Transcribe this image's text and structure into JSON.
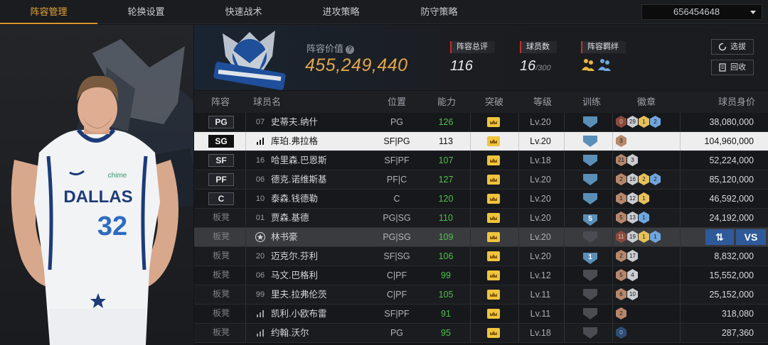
{
  "nav": {
    "tabs": [
      "阵容管理",
      "轮换设置",
      "快速战术",
      "进攻策略",
      "防守策略"
    ],
    "active_index": 0,
    "account_id": "656454648"
  },
  "team": {
    "value_label": "阵容价值",
    "value": "455,249,440",
    "stats": [
      {
        "label": "阵容总评",
        "value": "116"
      },
      {
        "label": "球员数",
        "value": "16",
        "suffix": "/300"
      },
      {
        "label": "阵容羁绊",
        "value": ""
      }
    ],
    "buttons": {
      "pick": "选拔",
      "recycle": "回收"
    }
  },
  "table": {
    "headers": [
      "阵容",
      "球员名",
      "位置",
      "能力",
      "突破",
      "等级",
      "训练",
      "徽章",
      "球员身价"
    ],
    "rows": [
      {
        "slot": "PG",
        "starter": true,
        "num": "07",
        "name": "史蒂夫.纳什",
        "pos": "PG",
        "ability": "126",
        "level": "Lv.20",
        "train": "crown",
        "badges": [
          [
            "red",
            "0"
          ],
          [
            "silver",
            "29"
          ],
          [
            "gold",
            "1"
          ],
          [
            "blue",
            "2"
          ]
        ],
        "value": "38,080,000"
      },
      {
        "slot": "SG",
        "starter": true,
        "num": "bars",
        "name": "库珀.弗拉格",
        "pos": "SF|PG",
        "ability": "113",
        "level": "Lv.20",
        "train": "crown",
        "badges": [
          [
            "bronze",
            "3"
          ]
        ],
        "value": "104,960,000",
        "selected": true
      },
      {
        "slot": "SF",
        "starter": true,
        "num": "16",
        "name": "哈里森.巴恩斯",
        "pos": "SF|PF",
        "ability": "107",
        "level": "Lv.18",
        "train": "crown",
        "badges": [
          [
            "bronze",
            "21"
          ],
          [
            "silver",
            "3"
          ]
        ],
        "value": "52,224,000"
      },
      {
        "slot": "PF",
        "starter": true,
        "num": "06",
        "name": "德克.诺维斯基",
        "pos": "PF|C",
        "ability": "127",
        "level": "Lv.20",
        "train": "crown",
        "badges": [
          [
            "bronze",
            "2"
          ],
          [
            "silver",
            "16"
          ],
          [
            "gold",
            "2"
          ],
          [
            "blue",
            "2"
          ]
        ],
        "value": "85,120,000"
      },
      {
        "slot": "C",
        "starter": true,
        "num": "10",
        "name": "泰森.钱德勒",
        "pos": "C",
        "ability": "120",
        "level": "Lv.20",
        "train": "crown",
        "badges": [
          [
            "bronze",
            "1"
          ],
          [
            "silver",
            "12"
          ],
          [
            "gold",
            "1"
          ]
        ],
        "value": "46,592,000"
      },
      {
        "slot": "板凳",
        "starter": false,
        "num": "01",
        "name": "贾森.基德",
        "pos": "PG|SG",
        "ability": "110",
        "level": "Lv.20",
        "train": "5",
        "badges": [
          [
            "bronze",
            "5"
          ],
          [
            "silver",
            "13"
          ],
          [
            "blue",
            "1"
          ]
        ],
        "value": "24,192,000"
      },
      {
        "slot": "板凳",
        "starter": false,
        "num": "star",
        "name": "林书豪",
        "pos": "PG|SG",
        "ability": "109",
        "level": "Lv.20",
        "train": "dim",
        "badges": [
          [
            "red",
            "11"
          ],
          [
            "silver",
            "19"
          ],
          [
            "gold",
            "1"
          ],
          [
            "blue",
            "1"
          ]
        ],
        "value": "",
        "highlight": true
      },
      {
        "slot": "板凳",
        "starter": false,
        "num": "20",
        "name": "迈克尔.芬利",
        "pos": "SF|SG",
        "ability": "106",
        "level": "Lv.20",
        "train": "1",
        "badges": [
          [
            "bronze",
            "2"
          ],
          [
            "silver",
            "17"
          ]
        ],
        "value": "8,832,000"
      },
      {
        "slot": "板凳",
        "starter": false,
        "num": "06",
        "name": "马文.巴格利",
        "pos": "C|PF",
        "ability": "99",
        "level": "Lv.12",
        "train": "dim",
        "badges": [
          [
            "bronze",
            "5"
          ],
          [
            "silver",
            "4"
          ]
        ],
        "value": "15,552,000"
      },
      {
        "slot": "板凳",
        "starter": false,
        "num": "99",
        "name": "里夫.拉弗伦茨",
        "pos": "C|PF",
        "ability": "105",
        "level": "Lv.11",
        "train": "dim",
        "badges": [
          [
            "bronze",
            "6"
          ],
          [
            "silver",
            "10"
          ]
        ],
        "value": "25,152,000"
      },
      {
        "slot": "板凳",
        "starter": false,
        "num": "bars",
        "name": "凯利.小欧布雷",
        "pos": "SF|PF",
        "ability": "91",
        "level": "Lv.11",
        "train": "dim",
        "badges": [
          [
            "bronze",
            "2"
          ]
        ],
        "value": "318,080"
      },
      {
        "slot": "板凳",
        "starter": false,
        "num": "bars",
        "name": "约翰.沃尔",
        "pos": "PG",
        "ability": "95",
        "level": "Lv.18",
        "train": "dim",
        "badges": [
          [
            "navy",
            "0"
          ]
        ],
        "value": "287,360"
      }
    ],
    "compare": {
      "swap": "⇅",
      "vs": "VS"
    }
  },
  "player_card": {
    "jersey_team": "DALLAS",
    "jersey_number": "32",
    "sponsor": "chime"
  },
  "colors": {
    "accent": "#d9962c",
    "ability_green": "#4cc24a",
    "vs_blue": "#2f5a9a"
  }
}
